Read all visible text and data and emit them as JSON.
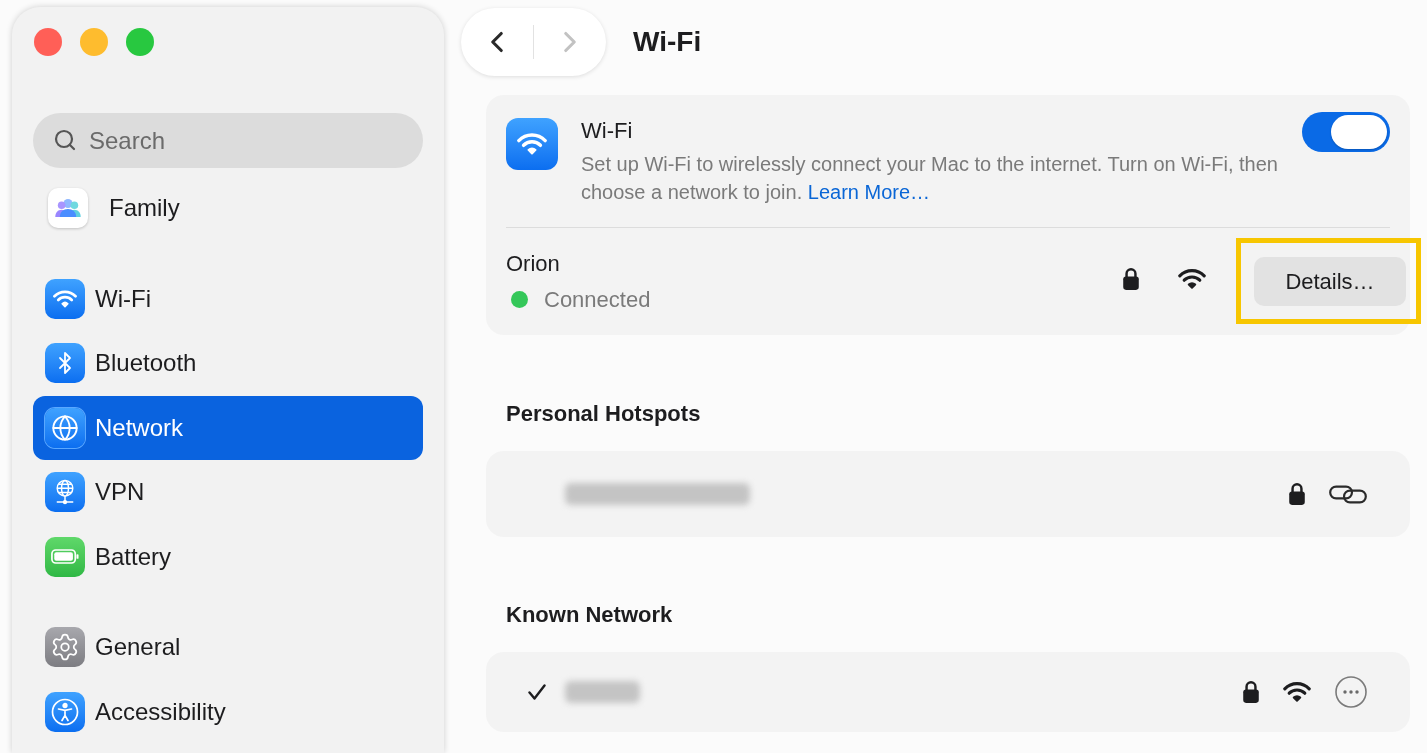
{
  "sidebar": {
    "search": {
      "placeholder": "Search"
    },
    "groups": [
      {
        "items": [
          {
            "label": "Family",
            "kind": "family",
            "selected": false
          }
        ]
      },
      {
        "items": [
          {
            "label": "Wi-Fi",
            "kind": "wifi",
            "selected": false
          },
          {
            "label": "Bluetooth",
            "kind": "bluetooth",
            "selected": false
          },
          {
            "label": "Network",
            "kind": "network",
            "selected": true
          },
          {
            "label": "VPN",
            "kind": "vpn",
            "selected": false
          },
          {
            "label": "Battery",
            "kind": "battery",
            "selected": false
          }
        ]
      },
      {
        "items": [
          {
            "label": "General",
            "kind": "general",
            "selected": false
          },
          {
            "label": "Accessibility",
            "kind": "accessibility",
            "selected": false
          }
        ]
      }
    ]
  },
  "toolbar": {
    "nav": [
      {
        "kind": "back",
        "disabled": false
      },
      {
        "kind": "forward",
        "disabled": true
      }
    ],
    "title": "Wi-Fi"
  },
  "wifi_card": {
    "title": "Wi-Fi",
    "description": "Set up Wi-Fi to wirelessly connect your Mac to the internet. Turn on Wi-Fi, then choose a network to join.",
    "link": "Learn More…",
    "on": true,
    "network": {
      "name": "Orion",
      "status": "Connected",
      "color": "#34c759",
      "locked": true,
      "details_button": {
        "label": "Details…",
        "highlighted": true
      }
    }
  },
  "sections": [
    {
      "title": "Personal Hotspots",
      "networks": [
        {
          "kind": "hotspot",
          "checked": false,
          "locked": true
        }
      ]
    },
    {
      "title": "Known Network",
      "networks": [
        {
          "kind": "wifi",
          "checked": true,
          "locked": true
        }
      ]
    }
  ]
}
